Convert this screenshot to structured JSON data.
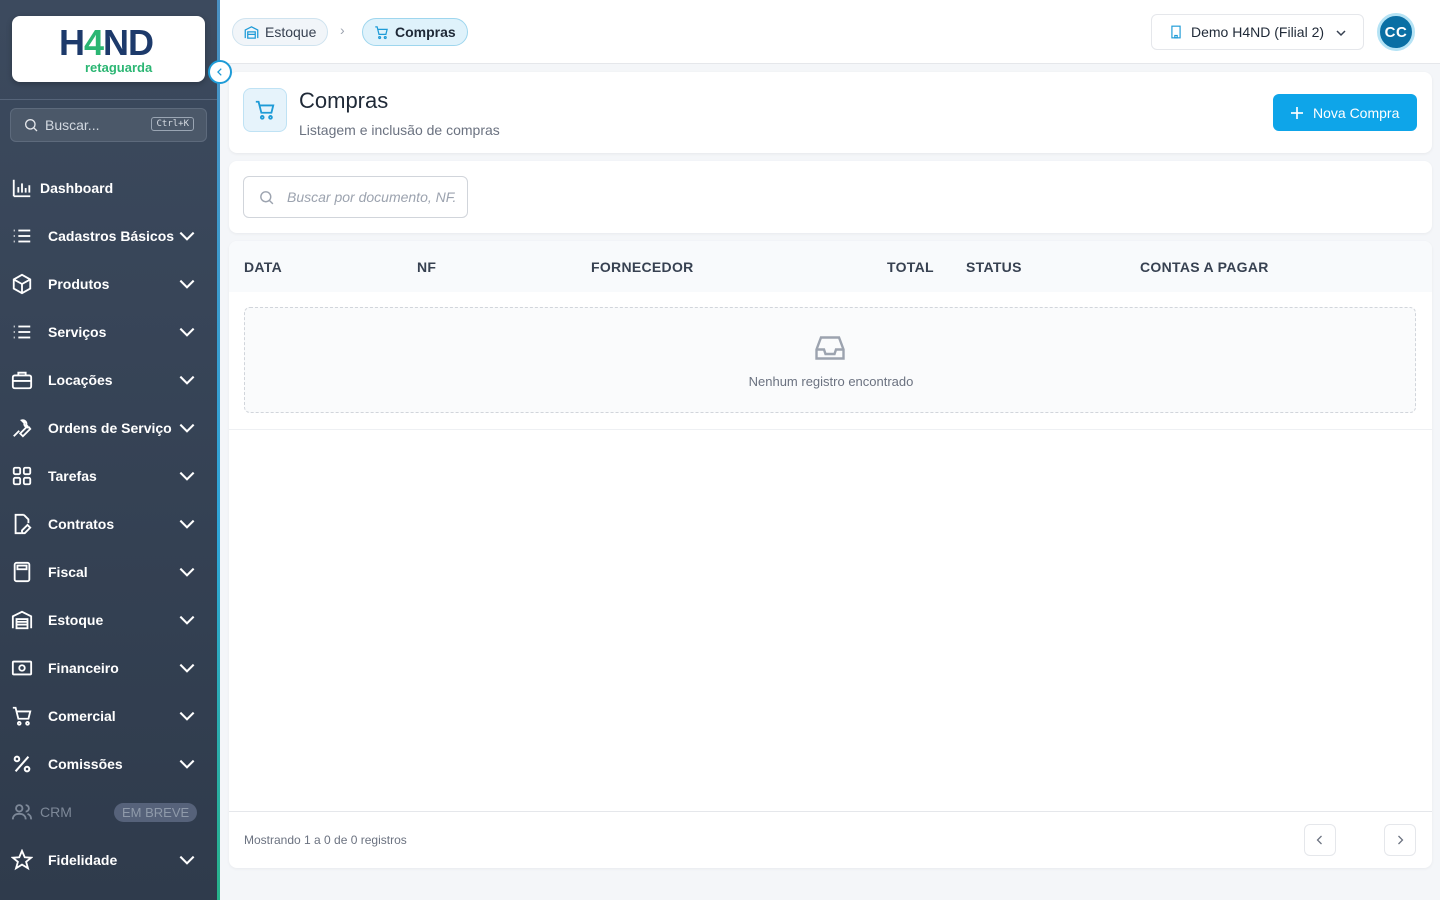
{
  "app": {
    "logo": "H4ND",
    "logo_sub": "retaguarda"
  },
  "sidebar": {
    "search_placeholder": "Buscar...",
    "search_shortcut": "Ctrl+K",
    "items": [
      {
        "label": "Dashboard",
        "icon": "chart-bar-icon",
        "expandable": false
      },
      {
        "label": "Cadastros Básicos",
        "icon": "list-icon",
        "expandable": true
      },
      {
        "label": "Produtos",
        "icon": "cube-icon",
        "expandable": true
      },
      {
        "label": "Serviços",
        "icon": "list-icon",
        "expandable": true
      },
      {
        "label": "Locações",
        "icon": "briefcase-icon",
        "expandable": true
      },
      {
        "label": "Ordens de Serviço",
        "icon": "wrench-icon",
        "expandable": true
      },
      {
        "label": "Tarefas",
        "icon": "grid-icon",
        "expandable": true
      },
      {
        "label": "Contratos",
        "icon": "document-edit-icon",
        "expandable": true
      },
      {
        "label": "Fiscal",
        "icon": "calculator-icon",
        "expandable": true
      },
      {
        "label": "Estoque",
        "icon": "warehouse-icon",
        "expandable": true
      },
      {
        "label": "Financeiro",
        "icon": "money-icon",
        "expandable": true
      },
      {
        "label": "Comercial",
        "icon": "cart-icon",
        "expandable": true
      },
      {
        "label": "Comissões",
        "icon": "percent-icon",
        "expandable": true
      },
      {
        "label": "CRM",
        "icon": "users-icon",
        "badge": "EM BREVE",
        "disabled": true
      },
      {
        "label": "Fidelidade",
        "icon": "star-icon",
        "expandable": true
      }
    ]
  },
  "topbar": {
    "breadcrumbs": [
      {
        "label": "Estoque",
        "icon": "warehouse-icon"
      },
      {
        "label": "Compras",
        "icon": "cart-icon"
      }
    ],
    "branch": "Demo H4ND (Filial 2)",
    "avatar_initials": "CC"
  },
  "header": {
    "title": "Compras",
    "subtitle": "Listagem e inclusão de compras",
    "new_button": "Nova Compra"
  },
  "filter": {
    "search_placeholder": "Buscar por documento, NF..."
  },
  "table": {
    "columns": [
      "DATA",
      "NF",
      "FORNECEDOR",
      "TOTAL",
      "STATUS",
      "CONTAS A PAGAR"
    ],
    "rows": [],
    "empty_text": "Nenhum registro encontrado",
    "footer": "Mostrando 1 a 0 de 0 registros"
  },
  "colors": {
    "sidebar_bg": "#3c4a5e",
    "accent": "#0ea5e9",
    "brand_dark": "#1d3a6b",
    "brand_green": "#2bb673"
  }
}
